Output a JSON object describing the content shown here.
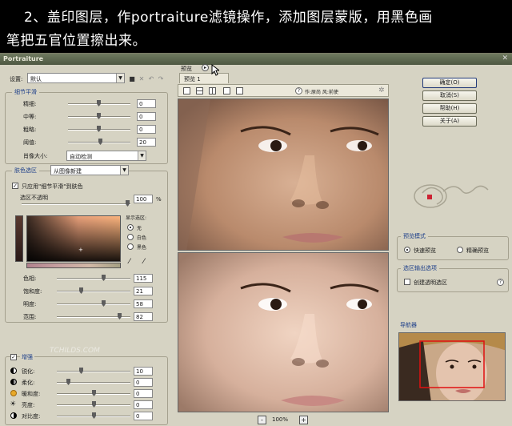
{
  "instruction": {
    "line1": "2、盖印图层，作portraiture滤镜操作，添加图层蒙版，用黑色画",
    "line2": "笔把五官位置擦出来。"
  },
  "window": {
    "title": "Portraiture"
  },
  "settings": {
    "label": "设置:",
    "value": "默认"
  },
  "detail_smoothing": {
    "title": "细节平滑",
    "rows": [
      {
        "label": "精细:",
        "value": "0"
      },
      {
        "label": "中等:",
        "value": "0"
      },
      {
        "label": "粗略:",
        "value": "0"
      },
      {
        "label": "阈值:",
        "value": "20"
      }
    ],
    "portrait_size_label": "肖像大小:",
    "portrait_size_value": "自动检测"
  },
  "skin_mask": {
    "title": "肤色选区",
    "source_value": "从图像新建",
    "apply_only_label": "只应用\"细节平滑\"到肤色",
    "opacity_label": "选区不透明",
    "opacity_value": "100",
    "opacity_unit": "%",
    "show_mask_label": "显示选区:",
    "show_options": [
      "无",
      "白色",
      "黑色"
    ],
    "rows": [
      {
        "label": "色相:",
        "value": "115"
      },
      {
        "label": "饱和度:",
        "value": "21"
      },
      {
        "label": "明度:",
        "value": "58"
      },
      {
        "label": "范围:",
        "value": "82"
      }
    ]
  },
  "enhance": {
    "title": "增强",
    "rows": [
      {
        "label": "锐化:",
        "value": "10"
      },
      {
        "label": "柔化:",
        "value": "0"
      },
      {
        "label": "暖和度:",
        "value": "0"
      },
      {
        "label": "亮度:",
        "value": "0"
      },
      {
        "label": "对比度:",
        "value": "0"
      }
    ]
  },
  "preview": {
    "label": "预览",
    "tab": "预览 1",
    "hint": "作:原尚 风:前使",
    "zoom": "100%",
    "zoom_minus": "-",
    "zoom_plus": "+"
  },
  "buttons": {
    "ok": "确定(O)",
    "cancel": "取消(S)",
    "help": "帮助(H)",
    "about": "关于(A)"
  },
  "preview_mode": {
    "title": "预览模式",
    "options": [
      "快速预览",
      "精确预览"
    ]
  },
  "output": {
    "title": "选区输出选项",
    "create_transparent": "创建透明选区"
  },
  "navigator": {
    "title": "导航器"
  },
  "watermark": "TCHILDS.COM"
}
